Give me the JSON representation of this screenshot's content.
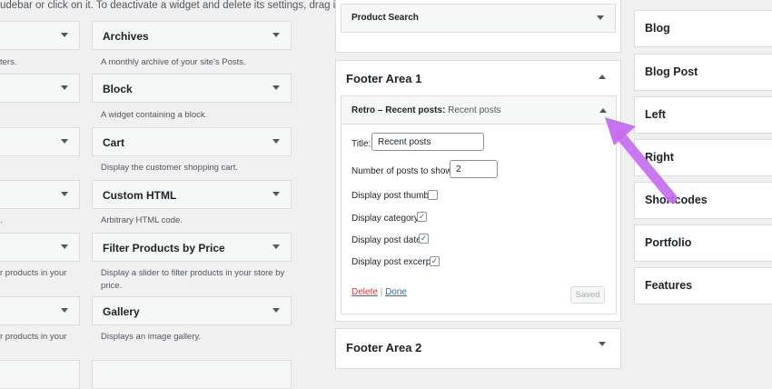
{
  "intro_text": "udebar or click on it. To deactivate a widget and delete its settings, drag it back.",
  "available_widgets": {
    "left_column_descs": [
      "ters.",
      ".",
      "r products in your",
      "r products in your"
    ],
    "widgets": [
      {
        "name": "Archives",
        "desc": "A monthly archive of your site's Posts."
      },
      {
        "name": "Block",
        "desc": "A widget containing a block."
      },
      {
        "name": "Cart",
        "desc": "Display the customer shopping cart."
      },
      {
        "name": "Custom HTML",
        "desc": "Arbitrary HTML code."
      },
      {
        "name": "Filter Products by Price",
        "desc_line1": "Display a slider to filter products in your store by",
        "desc_line2": "price."
      },
      {
        "name": "Gallery",
        "desc": "Displays an image gallery."
      }
    ]
  },
  "sidebars": {
    "product_search": "Product Search",
    "footer_area_1": {
      "title": "Footer Area 1",
      "widget": {
        "head_bold": "Retro – Recent posts:",
        "head_sub": "Recent posts",
        "title_label": "Title:",
        "title_value": "Recent posts",
        "num_label": "Number of posts to show:",
        "num_value": "2",
        "thumb_label": "Display post thumb:",
        "category_label": "Display category:",
        "date_label": "Display post date:",
        "excerpt_label": "Display post excerpt:",
        "thumb_checked": false,
        "category_checked": true,
        "date_checked": true,
        "excerpt_checked": true,
        "delete_label": "Delete",
        "separator": "|",
        "done_label": "Done",
        "saved_label": "Saved"
      }
    },
    "footer_area_2": "Footer Area 2"
  },
  "right_sidebars": [
    "Blog",
    "Blog Post",
    "Left",
    "Right",
    "Shortcodes",
    "Portfolio",
    "Features"
  ],
  "colors": {
    "arrow": "#c56cf0",
    "link_blue": "#2271b1",
    "delete_red": "#d63638"
  },
  "icons": {
    "check": "✓"
  }
}
